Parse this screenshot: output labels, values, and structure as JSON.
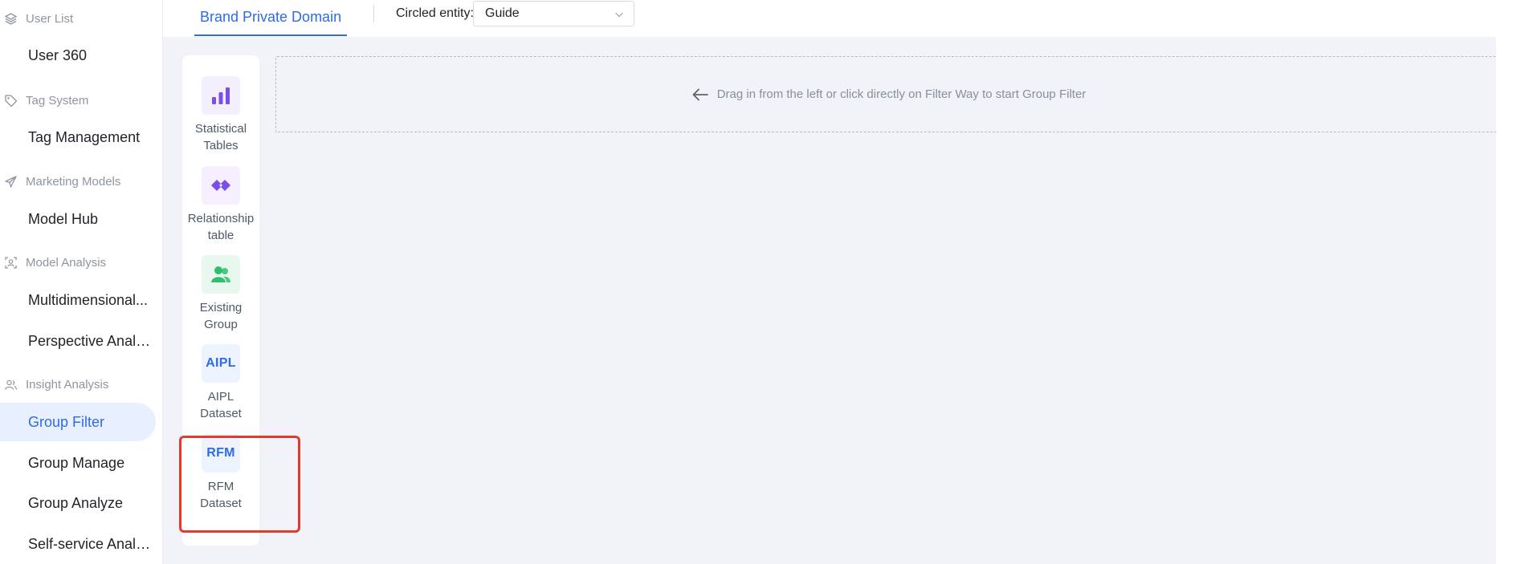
{
  "sidebar": {
    "groups": [
      {
        "label": "User List",
        "icon": "layers-icon"
      },
      {
        "label": "Tag System",
        "icon": "tag-icon"
      },
      {
        "label": "Marketing Models",
        "icon": "send-icon"
      },
      {
        "label": "Model Analysis",
        "icon": "scan-user-icon"
      },
      {
        "label": "Insight Analysis",
        "icon": "users-icon"
      }
    ],
    "items": [
      {
        "label": "User 360"
      },
      {
        "label": "Tag Management"
      },
      {
        "label": "Model Hub"
      },
      {
        "label": "Multidimensional..."
      },
      {
        "label": "Perspective Analy..."
      },
      {
        "label": "Group Filter",
        "active": true
      },
      {
        "label": "Group Manage"
      },
      {
        "label": "Group Analyze"
      },
      {
        "label": "Self-service Analy..."
      }
    ]
  },
  "topbar": {
    "tab_label": "Brand Private Domain",
    "entity_label": "Circled entity:",
    "entity_value": "Guide"
  },
  "filter_ways": [
    {
      "label_line1": "Statistical",
      "label_line2": "Tables",
      "icon": "bar-chart-icon"
    },
    {
      "label_line1": "Relationship",
      "label_line2": "table",
      "icon": "relationship-icon"
    },
    {
      "label_line1": "Existing",
      "label_line2": "Group",
      "icon": "group-icon"
    },
    {
      "label_line1": "AIPL",
      "label_line2": "Dataset",
      "icon_text": "AIPL"
    },
    {
      "label_line1": "RFM",
      "label_line2": "Dataset",
      "icon_text": "RFM"
    }
  ],
  "dropzone": {
    "hint": "Drag in from the left or click directly on Filter Way to start Group Filter"
  },
  "colors": {
    "accent": "#2e6be6",
    "active_bg": "#e8f0ff",
    "highlight": "#e43a2e",
    "purple": "#7b4ee8",
    "green": "#2fbf6c"
  }
}
